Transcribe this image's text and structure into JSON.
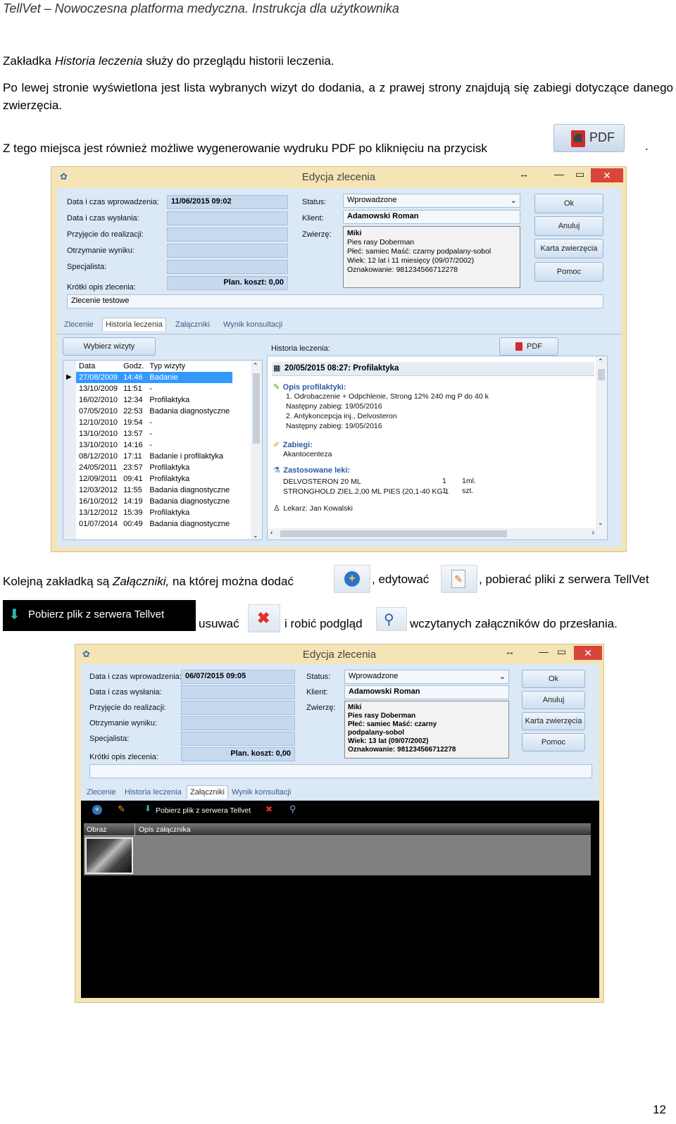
{
  "doc": {
    "header": "TellVet – Nowoczesna platforma medyczna. Instrukcja dla użytkownika",
    "p1_pre": "Zakładka ",
    "p1_em": "Historia leczenia",
    "p1_post": " służy do przeglądu historii leczenia.",
    "p2": "Po lewej stronie wyświetlona jest lista wybranych wizyt do dodania, a z prawej strony znajdują się zabiegi dotyczące danego zwierzęcia.",
    "p3": "Z tego miejsca jest również możliwe wygenerowanie wydruku PDF po kliknięciu na przycisk",
    "p3_end": ".",
    "pdf_button_label": "PDF",
    "p4_a": "Kolejną zakładką są ",
    "p4_em": "Załączniki,",
    "p4_b": " na której można dodać",
    "p4_c": ", edytować",
    "p4_d": ", pobierać pliki z serwera TellVet",
    "p4_download_btn": "Pobierz plik z serwera Tellvet",
    "p4_e": "usuwać",
    "p4_f": "i robić podgląd",
    "p4_g": "wczytanych załączników do przesłania.",
    "page_number": "12"
  },
  "win1": {
    "title": "Edycja zlecenia",
    "labels": {
      "date_in": "Data i czas wprowadzenia:",
      "date_sent": "Data i czas wysłania:",
      "accepted": "Przyjęcie do realizacji:",
      "result": "Otrzymanie wyniku:",
      "specialist": "Specjalista:",
      "short_desc": "Krótki opis zlecenia:",
      "status": "Status:",
      "client": "Klient:",
      "animal": "Zwierzę:"
    },
    "date_in_value": "11/06/2015 09:02",
    "plan_cost": "Plan. koszt: 0,00",
    "short_desc_value": "Zlecenie testowe",
    "status_value": "Wprowadzone",
    "client_value": "Adamowski Roman",
    "animal_lines": [
      "Miki",
      "Pies rasy Doberman",
      "Płeć: samiec  Maść: czarny podpalany-sobol",
      "Wiek: 12 lat i 11 miesięcy (09/07/2002)",
      "Oznakowanie: 981234566712278"
    ],
    "buttons": [
      "Ok",
      "Anuluj",
      "Karta zwierzęcia",
      "Pomoc"
    ],
    "tabs": [
      "Zlecenie",
      "Historia leczenia",
      "Załączniki",
      "Wynik konsultacji"
    ],
    "choose_visits": "Wybierz wizyty",
    "history_label": "Historia leczenia:",
    "pdf": "PDF",
    "visit_headers": [
      "Data",
      "Godz.",
      "Typ wizyty"
    ],
    "visits": [
      [
        "27/08/2009",
        "14:46",
        "Badanie"
      ],
      [
        "13/10/2009",
        "11:51",
        "-"
      ],
      [
        "16/02/2010",
        "12:34",
        "Profilaktyka"
      ],
      [
        "07/05/2010",
        "22:53",
        "Badania diagnostyczne"
      ],
      [
        "12/10/2010",
        "19:54",
        "-"
      ],
      [
        "13/10/2010",
        "13:57",
        "-"
      ],
      [
        "13/10/2010",
        "14:16",
        "-"
      ],
      [
        "08/12/2010",
        "17:11",
        "Badanie i profilaktyka"
      ],
      [
        "24/05/2011",
        "23:57",
        "Profilaktyka"
      ],
      [
        "12/09/2011",
        "09:41",
        "Profilaktyka"
      ],
      [
        "12/03/2012",
        "11:55",
        "Badania diagnostyczne"
      ],
      [
        "16/10/2012",
        "14:19",
        "Badania diagnostyczne"
      ],
      [
        "13/12/2012",
        "15:39",
        "Profilaktyka"
      ],
      [
        "01/07/2014",
        "00:49",
        "Badania diagnostyczne"
      ]
    ],
    "history": {
      "entry_title": "20/05/2015 08:27: Profilaktyka",
      "prof_title": "Opis profilaktyki:",
      "prof_lines": [
        "1. Odrobaczenie + Odpchlenie, Strong 12%  240 mg P do 40 k",
        "Następny zabieg: 19/05/2016",
        "2. Antykoncepcja inj., Delvosteron",
        "Następny zabieg: 19/05/2016"
      ],
      "proc_title": "Zabiegi:",
      "proc_lines": [
        "Akantocenteza"
      ],
      "drugs_title": "Zastosowane leki:",
      "drugs": [
        [
          "DELVOSTERON 20 ML",
          "1",
          "1ml."
        ],
        [
          "STRONGHOLD ZIEL.2,00 ML PIES (20,1-40 KG 1",
          "1",
          "szt."
        ]
      ],
      "doctor": "Lekarz: Jan Kowalski"
    }
  },
  "win2": {
    "title": "Edycja zlecenia",
    "date_in_value": "06/07/2015 09:05",
    "plan_cost": "Plan. koszt: 0,00",
    "status_value": "Wprowadzone",
    "client_value": "Adamowski Roman",
    "animal_lines": [
      "Miki",
      "Pies rasy Doberman",
      "Płeć: samiec  Maść: czarny",
      "podpalany-sobol",
      "Wiek: 13 lat (09/07/2002)",
      "Oznakowanie: 981234566712278"
    ],
    "download_label": "Pobierz plik z serwera Tellvet",
    "col_image": "Obraz",
    "col_desc": "Opis załącznika"
  },
  "colors": {
    "window_frame": "#f5e4b5",
    "panel": "#dbe8f6",
    "selection": "#3399ff",
    "pdf_red": "#d42a2a"
  }
}
